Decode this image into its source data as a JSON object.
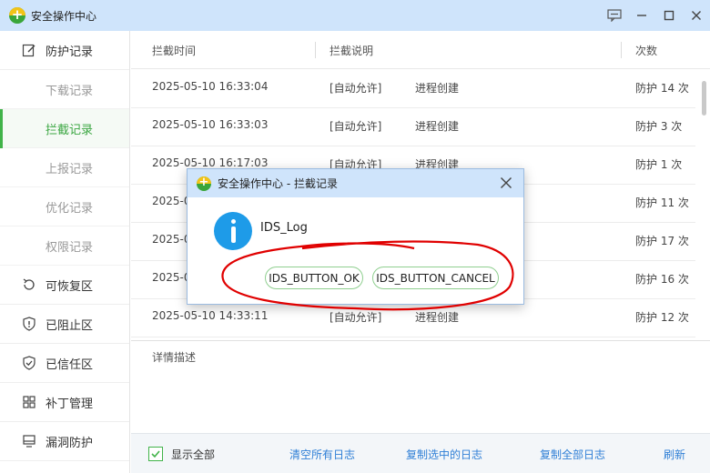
{
  "window": {
    "title": "安全操作中心",
    "icons": [
      "app-logo-icon",
      "feedback-icon",
      "minimize-icon",
      "maximize-icon",
      "close-icon"
    ]
  },
  "sidebar": {
    "sections": [
      {
        "label": "防护记录",
        "icon": "edit-icon"
      },
      {
        "label": "下载记录",
        "sub": true
      },
      {
        "label": "拦截记录",
        "sub": true,
        "active": true
      },
      {
        "label": "上报记录",
        "sub": true
      },
      {
        "label": "优化记录",
        "sub": true
      },
      {
        "label": "权限记录",
        "sub": true
      },
      {
        "label": "可恢复区",
        "icon": "restore-icon"
      },
      {
        "label": "已阻止区",
        "icon": "shield-alert-icon"
      },
      {
        "label": "已信任区",
        "icon": "shield-check-icon"
      },
      {
        "label": "补丁管理",
        "icon": "grid-icon"
      },
      {
        "label": "漏洞防护",
        "icon": "monitor-icon"
      }
    ]
  },
  "table": {
    "columns": [
      "拦截时间",
      "拦截说明",
      "次数"
    ],
    "rows": [
      {
        "time": "2025-05-10 16:33:04",
        "tag": "[自动允许]",
        "desc": "进程创建",
        "count": "防护 14 次"
      },
      {
        "time": "2025-05-10 16:33:03",
        "tag": "[自动允许]",
        "desc": "进程创建",
        "count": "防护 3 次"
      },
      {
        "time": "2025-05-10 16:17:03",
        "tag": "[自动允许]",
        "desc": "进程创建",
        "count": "防护 1 次"
      },
      {
        "time": "2025-0",
        "tag": "",
        "desc": "",
        "count": "防护 11 次"
      },
      {
        "time": "2025-0",
        "tag": "",
        "desc": "",
        "count": "防护 17 次"
      },
      {
        "time": "2025-0",
        "tag": "",
        "desc": "",
        "count": "防护 16 次"
      },
      {
        "time": "2025-05-10 14:33:11",
        "tag": "[自动允许]",
        "desc": "进程创建",
        "count": "防护 12 次"
      }
    ]
  },
  "details": {
    "label": "详情描述"
  },
  "footer": {
    "show_all": "显示全部",
    "show_all_checked": true,
    "clear_all": "清空所有日志",
    "copy_selected": "复制选中的日志",
    "copy_all": "复制全部日志",
    "refresh": "刷新"
  },
  "dialog": {
    "title": "安全操作中心 - 拦截记录",
    "message": "IDS_Log",
    "ok_label": "IDS_BUTTON_OK",
    "cancel_label": "IDS_BUTTON_CANCEL",
    "icon": "info-icon"
  },
  "colors": {
    "titlebar": "#cfe4fb",
    "accent_green": "#41b349",
    "link_blue": "#2f7fd6",
    "annotation_red": "#e00000"
  }
}
